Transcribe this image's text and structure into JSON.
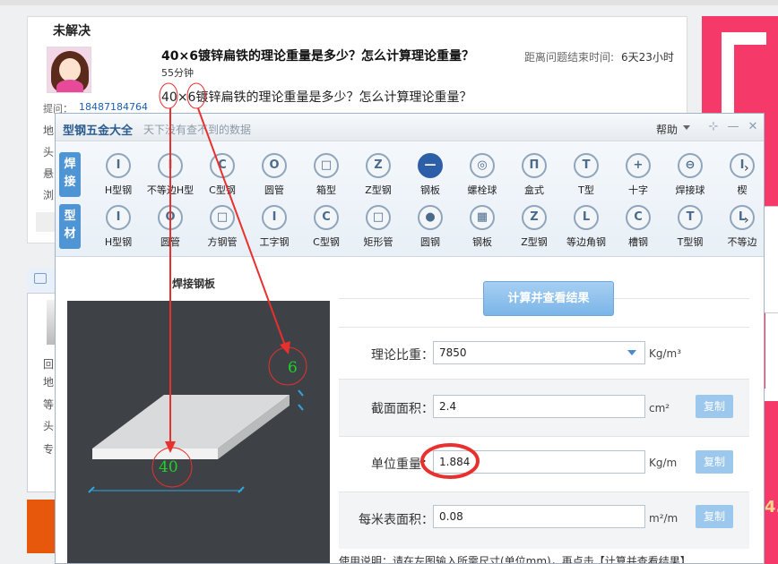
{
  "background_page": {
    "section_heading": "未解决",
    "question_title": "40×6镀锌扁铁的理论重量是多少？怎么计算理论重量？",
    "elapsed": "55分钟",
    "deadline_label": "距离问题结束时间:",
    "deadline_value": "6天23小时",
    "question_body": "40×6镀锌扁铁的理论重量是多少？怎么计算理论重量？",
    "asker_label": "提问：",
    "asker_phone": "18487184764",
    "side_labels_top": [
      "地",
      "头",
      "悬",
      "浏"
    ],
    "side_labels_bottom": [
      "回",
      "地",
      "等",
      "头",
      "专"
    ],
    "ad_number": "4."
  },
  "app": {
    "title": "型钢五金大全",
    "slogan": "天下没有查不到的数据",
    "help": "帮助",
    "window_controls": [
      "⊹",
      "—",
      "✕"
    ],
    "categories": [
      {
        "label": "焊接",
        "color": "#4f95d4"
      },
      {
        "label": "型材",
        "color": "#4f95d4"
      }
    ],
    "welded_items": [
      {
        "icon": "I",
        "label": "H型钢"
      },
      {
        "icon": "I",
        "label": "不等边H型"
      },
      {
        "icon": "C",
        "label": "C型钢"
      },
      {
        "icon": "O",
        "label": "圆管"
      },
      {
        "icon": "□",
        "label": "箱型"
      },
      {
        "icon": "Z",
        "label": "Z型钢"
      },
      {
        "icon": "—",
        "label": "钢板",
        "selected": true
      },
      {
        "icon": "◎",
        "label": "螺栓球"
      },
      {
        "icon": "Π",
        "label": "盒式"
      },
      {
        "icon": "T",
        "label": "T型"
      },
      {
        "icon": "+",
        "label": "十字"
      },
      {
        "icon": "⊖",
        "label": "焊接球"
      },
      {
        "icon": "I",
        "label": "楔"
      }
    ],
    "profile_items": [
      {
        "icon": "I",
        "label": "H型钢"
      },
      {
        "icon": "O",
        "label": "圆管"
      },
      {
        "icon": "□",
        "label": "方钢管"
      },
      {
        "icon": "I",
        "label": "工字钢"
      },
      {
        "icon": "C",
        "label": "C型钢"
      },
      {
        "icon": "□",
        "label": "矩形管"
      },
      {
        "icon": "●",
        "label": "圆钢"
      },
      {
        "icon": "▦",
        "label": "钢板"
      },
      {
        "icon": "Z",
        "label": "Z型钢"
      },
      {
        "icon": "L",
        "label": "等边角钢"
      },
      {
        "icon": "C",
        "label": "槽钢"
      },
      {
        "icon": "T",
        "label": "T型钢"
      },
      {
        "icon": "L",
        "label": "不等边"
      }
    ],
    "preview_title": "焊接钢板",
    "calc_button": "计算并查看结果",
    "fields": [
      {
        "label": "理论比重：",
        "value": "7850",
        "unit": "Kg/m³",
        "dropdown": true
      },
      {
        "label": "截面面积：",
        "value": "2.4",
        "unit": "cm²",
        "copy": "复制"
      },
      {
        "label": "单位重量：",
        "value": "1.884",
        "unit": "Kg/m",
        "copy": "复制"
      },
      {
        "label": "每米表面积：",
        "value": "0.08",
        "unit": "m²/m",
        "copy": "复制"
      }
    ],
    "usage_note": "使用说明：请在左图输入所需尺寸(单位mm)，再点击【计算并查看结果】",
    "dimension_width": "40",
    "dimension_thickness": "6"
  },
  "colors": {
    "accent": "#4f95d4",
    "selected": "#2c5fa8",
    "annotation": "#e8302e",
    "dimension_text": "#1fd12a"
  }
}
